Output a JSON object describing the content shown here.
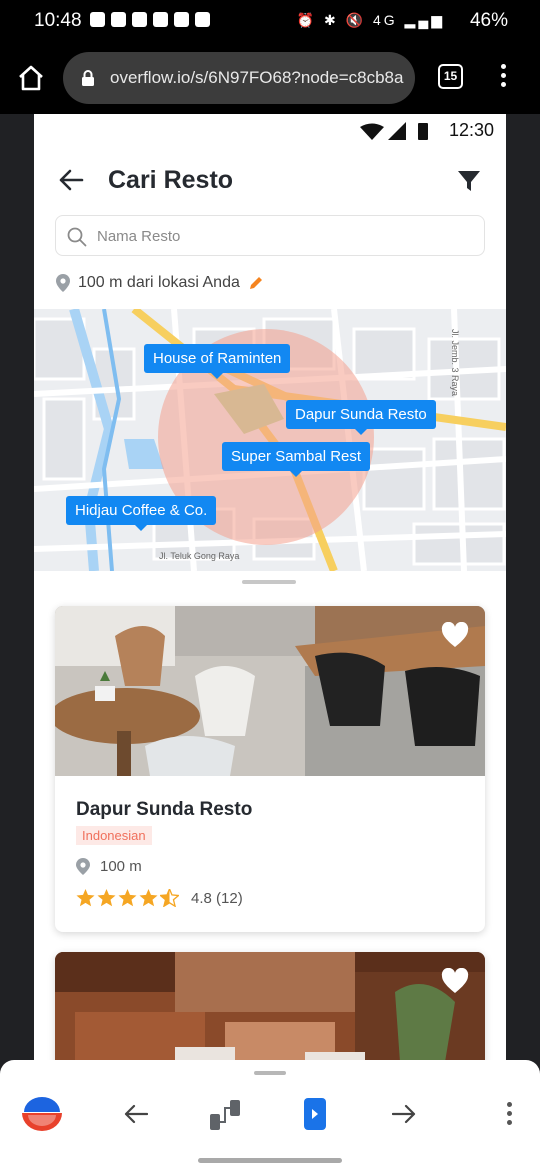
{
  "status_bar": {
    "time": "10:48",
    "system_icons": "⏰ ✱ 🔇 4G ▂▄▆",
    "battery": "46%"
  },
  "browser": {
    "url": "overflow.io/s/6N97FO68?node=c8cb8a",
    "tab_count": "15"
  },
  "app_status": {
    "time": "12:30"
  },
  "header": {
    "title": "Cari Resto"
  },
  "search": {
    "placeholder": "Nama Resto"
  },
  "location": {
    "text": "100 m dari lokasi Anda"
  },
  "map": {
    "pins": [
      "House of Raminten",
      "Dapur Sunda Resto",
      "Super Sambal Rest",
      "Hidjau Coffee & Co."
    ],
    "street_labels": [
      "Jl. Teluk Gong Raya",
      "Jl. Jemb. 3 Raya"
    ]
  },
  "restaurants": [
    {
      "name": "Dapur Sunda Resto",
      "cuisine": "Indonesian",
      "distance": "100 m",
      "rating": 4.5,
      "rating_text": "4.8 (12)"
    }
  ],
  "colors": {
    "accent": "#1288f2",
    "radius": "#f4a08e",
    "tag_bg": "#fde9e6",
    "tag_text": "#f0705c",
    "star": "#f5a623"
  }
}
